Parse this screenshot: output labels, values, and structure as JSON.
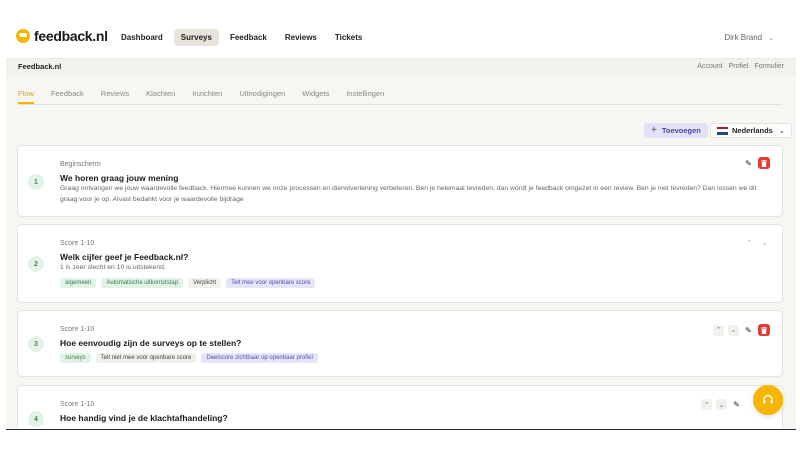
{
  "app": {
    "logo_text": "feedback.nl",
    "brand_color": "#f7b500"
  },
  "nav": {
    "items": [
      "Dashboard",
      "Surveys",
      "Feedback",
      "Reviews",
      "Tickets"
    ],
    "active": "Surveys",
    "user_name": "Dirk Brand"
  },
  "subbar": {
    "org_name": "Feedback.nl",
    "links": [
      "Account",
      "Profiel",
      "Formulier"
    ]
  },
  "tabs": {
    "items": [
      "Flow",
      "Feedback",
      "Reviews",
      "Klachten",
      "Inzichten",
      "Uitnodigingen",
      "Widgets",
      "Instellingen"
    ],
    "active": "Flow"
  },
  "actions": {
    "add_label": "Toevoegen",
    "language": "Nederlands"
  },
  "questions": [
    {
      "number": "1",
      "type": "Beginscherm",
      "title": "We horen graag jouw mening",
      "description": "Graag ontvangen we jouw waardevolle feedback. Hiermee kunnen we onze processen en dienstverlening verbeteren. Ben je helemaal tevreden, dan wordt je feedback omgezet in een review. Ben je niet tevreden? Dan lossen we dit graag voor je op. Alvast bedankt voor je waardevolle bijdrage",
      "tags": []
    },
    {
      "number": "2",
      "type": "Score 1-10",
      "title": "Welk cijfer geef je Feedback.nl?",
      "description": "1 is zeer slecht en 10 is uitstekend.",
      "tags": [
        "algemeen",
        "Automatische uitkomststap",
        "Verplicht",
        "Telt mee voor openbare score"
      ]
    },
    {
      "number": "3",
      "type": "Score 1-10",
      "title": "Hoe eenvoudig zijn de surveys op te stellen?",
      "description": "",
      "tags": [
        "surveys",
        "Telt niet mee voor openbare score",
        "Deelscore zichtbaar op openbaar profiel"
      ]
    },
    {
      "number": "4",
      "type": "Score 1-10",
      "title": "Hoe handig vind je de klachtafhandeling?",
      "description": "",
      "tags": []
    }
  ]
}
